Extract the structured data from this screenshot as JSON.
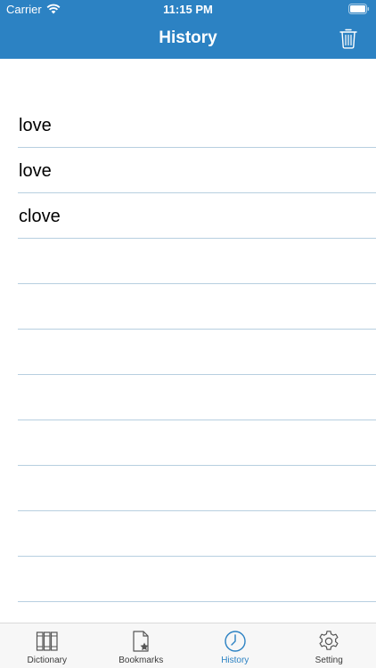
{
  "status_bar": {
    "carrier": "Carrier",
    "time": "11:15 PM"
  },
  "nav": {
    "title": "History",
    "trash_icon": "trash-icon"
  },
  "history": {
    "items": [
      {
        "word": "love"
      },
      {
        "word": "love"
      },
      {
        "word": "clove"
      },
      {
        "word": ""
      },
      {
        "word": ""
      },
      {
        "word": ""
      },
      {
        "word": ""
      },
      {
        "word": ""
      },
      {
        "word": ""
      },
      {
        "word": ""
      },
      {
        "word": ""
      },
      {
        "word": ""
      }
    ]
  },
  "tab_bar": {
    "active": "History",
    "tabs": [
      {
        "label": "Dictionary",
        "icon": "books-icon"
      },
      {
        "label": "Bookmarks",
        "icon": "bookmark-page-icon"
      },
      {
        "label": "History",
        "icon": "clock-icon"
      },
      {
        "label": "Setting",
        "icon": "gear-icon"
      }
    ]
  },
  "colors": {
    "header_bg": "#2c82c3",
    "accent": "#2c82c3",
    "row_separator": "#b7cfe0"
  }
}
